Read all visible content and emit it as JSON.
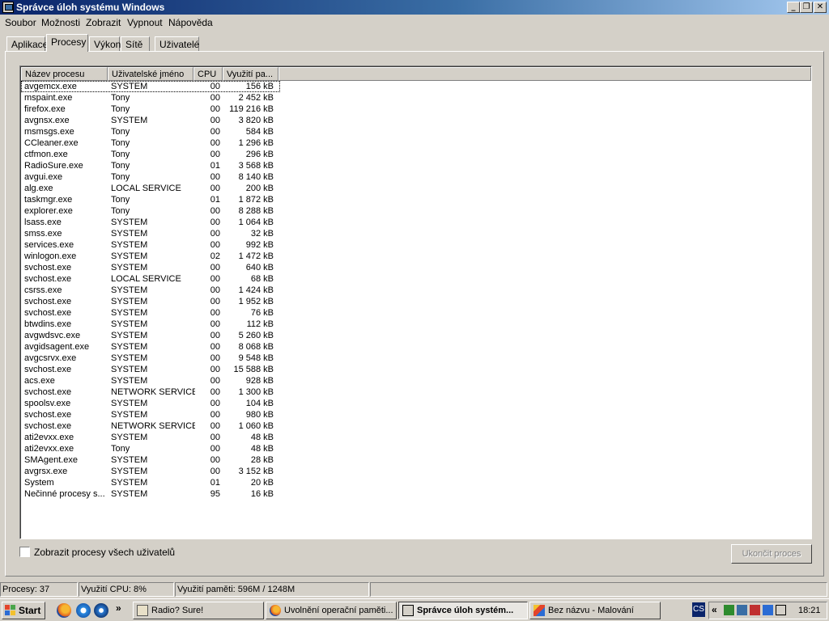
{
  "window": {
    "title": "Správce úloh systému Windows"
  },
  "menu": [
    "Soubor",
    "Možnosti",
    "Zobrazit",
    "Vypnout",
    "Nápověda"
  ],
  "tabs": [
    "Aplikace",
    "Procesy",
    "Výkon",
    "Sítě",
    "Uživatelé"
  ],
  "active_tab": "Procesy",
  "columns": {
    "name": "Název procesu",
    "user": "Uživatelské jméno",
    "cpu": "CPU",
    "mem": "Využití pa..."
  },
  "processes": [
    {
      "name": "avgemcx.exe",
      "user": "SYSTEM",
      "cpu": "00",
      "mem": "156 kB"
    },
    {
      "name": "mspaint.exe",
      "user": "Tony",
      "cpu": "00",
      "mem": "2 452 kB"
    },
    {
      "name": "firefox.exe",
      "user": "Tony",
      "cpu": "00",
      "mem": "119 216 kB"
    },
    {
      "name": "avgnsx.exe",
      "user": "SYSTEM",
      "cpu": "00",
      "mem": "3 820 kB"
    },
    {
      "name": "msmsgs.exe",
      "user": "Tony",
      "cpu": "00",
      "mem": "584 kB"
    },
    {
      "name": "CCleaner.exe",
      "user": "Tony",
      "cpu": "00",
      "mem": "1 296 kB"
    },
    {
      "name": "ctfmon.exe",
      "user": "Tony",
      "cpu": "00",
      "mem": "296 kB"
    },
    {
      "name": "RadioSure.exe",
      "user": "Tony",
      "cpu": "01",
      "mem": "3 568 kB"
    },
    {
      "name": "avgui.exe",
      "user": "Tony",
      "cpu": "00",
      "mem": "8 140 kB"
    },
    {
      "name": "alg.exe",
      "user": "LOCAL SERVICE",
      "cpu": "00",
      "mem": "200 kB"
    },
    {
      "name": "taskmgr.exe",
      "user": "Tony",
      "cpu": "01",
      "mem": "1 872 kB"
    },
    {
      "name": "explorer.exe",
      "user": "Tony",
      "cpu": "00",
      "mem": "8 288 kB"
    },
    {
      "name": "lsass.exe",
      "user": "SYSTEM",
      "cpu": "00",
      "mem": "1 064 kB"
    },
    {
      "name": "smss.exe",
      "user": "SYSTEM",
      "cpu": "00",
      "mem": "32 kB"
    },
    {
      "name": "services.exe",
      "user": "SYSTEM",
      "cpu": "00",
      "mem": "992 kB"
    },
    {
      "name": "winlogon.exe",
      "user": "SYSTEM",
      "cpu": "02",
      "mem": "1 472 kB"
    },
    {
      "name": "svchost.exe",
      "user": "SYSTEM",
      "cpu": "00",
      "mem": "640 kB"
    },
    {
      "name": "svchost.exe",
      "user": "LOCAL SERVICE",
      "cpu": "00",
      "mem": "68 kB"
    },
    {
      "name": "csrss.exe",
      "user": "SYSTEM",
      "cpu": "00",
      "mem": "1 424 kB"
    },
    {
      "name": "svchost.exe",
      "user": "SYSTEM",
      "cpu": "00",
      "mem": "1 952 kB"
    },
    {
      "name": "svchost.exe",
      "user": "SYSTEM",
      "cpu": "00",
      "mem": "76 kB"
    },
    {
      "name": "btwdins.exe",
      "user": "SYSTEM",
      "cpu": "00",
      "mem": "112 kB"
    },
    {
      "name": "avgwdsvc.exe",
      "user": "SYSTEM",
      "cpu": "00",
      "mem": "5 260 kB"
    },
    {
      "name": "avgidsagent.exe",
      "user": "SYSTEM",
      "cpu": "00",
      "mem": "8 068 kB"
    },
    {
      "name": "avgcsrvx.exe",
      "user": "SYSTEM",
      "cpu": "00",
      "mem": "9 548 kB"
    },
    {
      "name": "svchost.exe",
      "user": "SYSTEM",
      "cpu": "00",
      "mem": "15 588 kB"
    },
    {
      "name": "acs.exe",
      "user": "SYSTEM",
      "cpu": "00",
      "mem": "928 kB"
    },
    {
      "name": "svchost.exe",
      "user": "NETWORK SERVICE",
      "cpu": "00",
      "mem": "1 300 kB"
    },
    {
      "name": "spoolsv.exe",
      "user": "SYSTEM",
      "cpu": "00",
      "mem": "104 kB"
    },
    {
      "name": "svchost.exe",
      "user": "SYSTEM",
      "cpu": "00",
      "mem": "980 kB"
    },
    {
      "name": "svchost.exe",
      "user": "NETWORK SERVICE",
      "cpu": "00",
      "mem": "1 060 kB"
    },
    {
      "name": "ati2evxx.exe",
      "user": "SYSTEM",
      "cpu": "00",
      "mem": "48 kB"
    },
    {
      "name": "ati2evxx.exe",
      "user": "Tony",
      "cpu": "00",
      "mem": "48 kB"
    },
    {
      "name": "SMAgent.exe",
      "user": "SYSTEM",
      "cpu": "00",
      "mem": "28 kB"
    },
    {
      "name": "avgrsx.exe",
      "user": "SYSTEM",
      "cpu": "00",
      "mem": "3 152 kB"
    },
    {
      "name": "System",
      "user": "SYSTEM",
      "cpu": "01",
      "mem": "20 kB"
    },
    {
      "name": "Nečinné procesy s...",
      "user": "SYSTEM",
      "cpu": "95",
      "mem": "16 kB"
    }
  ],
  "show_all_users_label": "Zobrazit procesy všech uživatelů",
  "show_all_users_checked": false,
  "end_process_label": "Ukončit proces",
  "status": {
    "processes": "Procesy: 37",
    "cpu": "Využití CPU: 8%",
    "memory": "Využití paměti: 596M / 1248M"
  },
  "taskbar": {
    "start_label": "Start",
    "quicklaunch_more": "»",
    "buttons": [
      {
        "label": "Radio? Sure!",
        "icon": "radio-icon",
        "active": false
      },
      {
        "label": "Uvolnění operační paměti...",
        "icon": "firefox-icon",
        "active": false
      },
      {
        "label": "Správce úloh systém...",
        "icon": "taskmanager-icon",
        "active": true
      },
      {
        "label": "Bez názvu - Malování",
        "icon": "paint-icon",
        "active": false
      }
    ],
    "language": "CS",
    "tray_arrow": "«",
    "clock": "18:21"
  },
  "colors": {
    "title_start": "#0a246a",
    "title_end": "#a6caf0",
    "face": "#d4d0c8"
  }
}
